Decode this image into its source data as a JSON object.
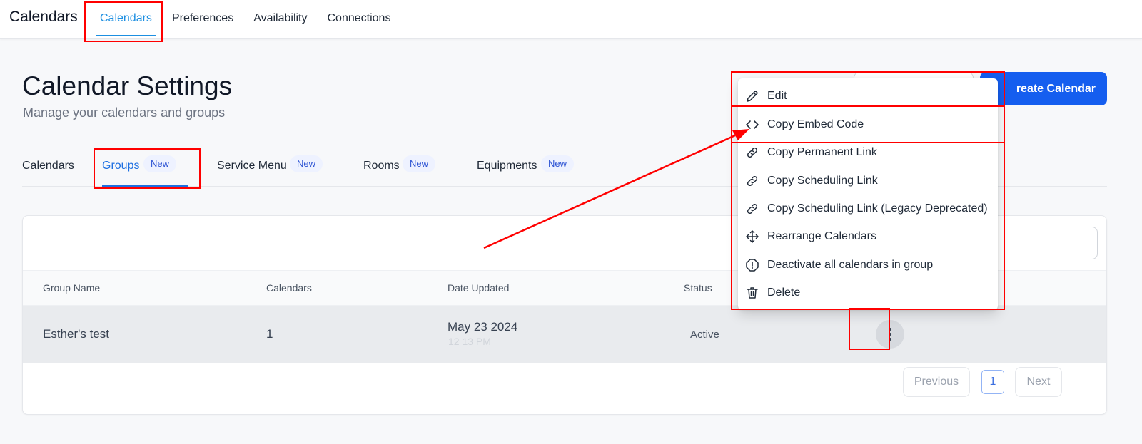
{
  "app": {
    "title": "Calendars"
  },
  "topnav": [
    {
      "label": "Calendars",
      "active": true
    },
    {
      "label": "Preferences",
      "active": false
    },
    {
      "label": "Availability",
      "active": false
    },
    {
      "label": "Connections",
      "active": false
    }
  ],
  "header": {
    "title": "Calendar Settings",
    "subtitle": "Manage your calendars and groups",
    "create_label": "reate Calendar"
  },
  "subtabs": [
    {
      "label": "Calendars",
      "badge": ""
    },
    {
      "label": "Groups",
      "badge": "New",
      "active": true
    },
    {
      "label": "Service Menu",
      "badge": "New"
    },
    {
      "label": "Rooms",
      "badge": "New"
    },
    {
      "label": "Equipments",
      "badge": "New"
    }
  ],
  "table": {
    "columns": [
      "Group Name",
      "Calendars",
      "Date Updated",
      "Status"
    ],
    "rows": [
      {
        "group_name": "Esther's test",
        "calendars": "1",
        "date": "May 23 2024",
        "time": "12 13 PM",
        "status": "Active"
      }
    ]
  },
  "pagination": {
    "previous": "Previous",
    "page": "1",
    "next": "Next"
  },
  "menu": {
    "items": [
      {
        "label": "Edit",
        "icon": "pencil-icon"
      },
      {
        "label": "Copy Embed Code",
        "icon": "code-icon"
      },
      {
        "label": "Copy Permanent Link",
        "icon": "link-icon"
      },
      {
        "label": "Copy Scheduling Link",
        "icon": "link-icon"
      },
      {
        "label": "Copy Scheduling Link (Legacy Deprecated)",
        "icon": "link-icon"
      },
      {
        "label": "Rearrange Calendars",
        "icon": "move-icon"
      },
      {
        "label": "Deactivate all calendars in group",
        "icon": "warning-octagon-icon"
      },
      {
        "label": "Delete",
        "icon": "trash-icon"
      }
    ]
  },
  "colors": {
    "accent": "#155eef",
    "tab_active": "#1d8fe1",
    "annotation": "#ff0000"
  }
}
